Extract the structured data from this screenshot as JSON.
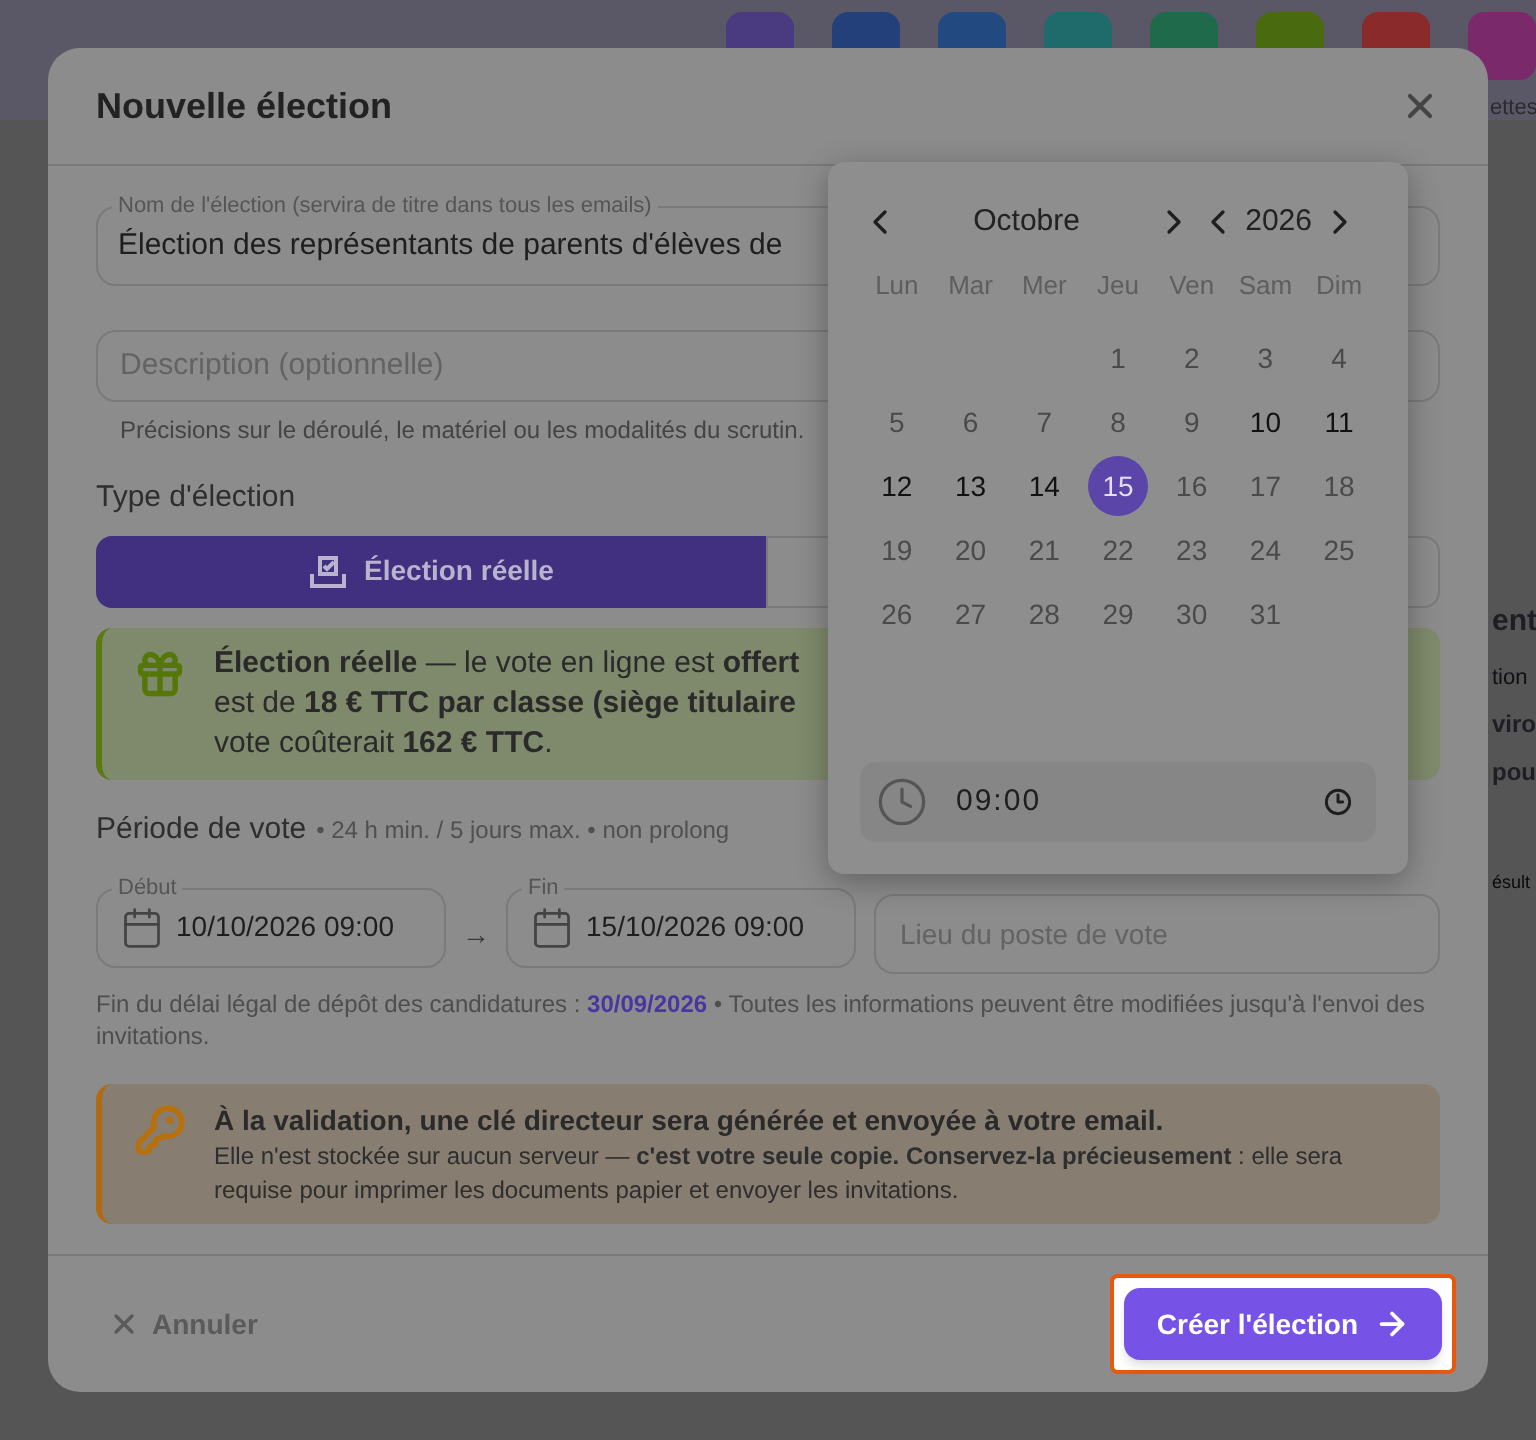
{
  "background": {
    "tiles": [
      {
        "color": "#4a3a80"
      },
      {
        "color": "#23407a"
      },
      {
        "color": "#234a80"
      },
      {
        "color": "#1f6a6a"
      },
      {
        "color": "#1f6a4a"
      },
      {
        "color": "#4a6a10"
      },
      {
        "color": "#8a2a2a"
      },
      {
        "color": "#7a2a6a"
      }
    ],
    "corner_label": "ettes",
    "fragments": [
      {
        "text": "ent",
        "kind": "heading"
      },
      {
        "text": "tion",
        "kind": "body"
      },
      {
        "text": "viro",
        "kind": "bold"
      },
      {
        "text": "pou",
        "kind": "bold"
      },
      {
        "text": "ésult",
        "kind": "small"
      }
    ]
  },
  "dialog": {
    "title": "Nouvelle élection",
    "name_field": {
      "label": "Nom de l'élection (servira de titre dans tous les emails)",
      "value": "Élection des représentants de parents d'élèves de"
    },
    "description_field": {
      "placeholder": "Description (optionnelle)",
      "hint": "Précisions sur le déroulé, le matériel ou les modalités du scrutin."
    },
    "type_label": "Type d'élection",
    "type_options": [
      {
        "label": "Élection réelle",
        "selected": true
      },
      {
        "selected": false
      }
    ],
    "offer_notice": [
      "**Élection réelle** — le vote en ligne est **offert**",
      "est de **18 € TTC par classe (siège titulaire**",
      "vote coûterait **162 € TTC**."
    ],
    "period": {
      "title": "Période de vote",
      "details": "• 24 h min. / 5 jours max. • non prolong",
      "start": {
        "label": "Début",
        "value": "10/10/2026 09:00"
      },
      "separator": "→",
      "end": {
        "label": "Fin",
        "value": "15/10/2026 09:00"
      },
      "place": {
        "placeholder": "Lieu du poste de vote"
      },
      "note": {
        "before": "Fin du délai légal de dépôt des candidatures : ",
        "date": "30/09/2026",
        "after": " • Toutes les informations peuvent être modifiées jusqu'à l'envoi des invitations."
      }
    },
    "key_notice": {
      "title": "À la validation, une clé directeur sera générée et envoyée à votre email.",
      "text": "Elle n'est stockée sur aucun serveur — **c'est votre seule copie. Conservez-la précieusement** : elle sera requise pour imprimer les documents papier et envoyer les invitations."
    },
    "footer": {
      "cancel": "Annuler",
      "submit": "Créer l'élection",
      "submit_highlighted": true
    }
  },
  "date_picker": {
    "month": "Octobre",
    "year": "2026",
    "weekdays": [
      "Lun",
      "Mar",
      "Mer",
      "Jeu",
      "Ven",
      "Sam",
      "Dim"
    ],
    "days": [
      {
        "kind": "blank"
      },
      {
        "kind": "blank"
      },
      {
        "kind": "blank"
      },
      {
        "kind": "day",
        "label": "1",
        "disabled": true,
        "selected": false
      },
      {
        "kind": "day",
        "label": "2",
        "disabled": true,
        "selected": false
      },
      {
        "kind": "day",
        "label": "3",
        "disabled": true,
        "selected": false
      },
      {
        "kind": "day",
        "label": "4",
        "disabled": true,
        "selected": false
      },
      {
        "kind": "day",
        "label": "5",
        "disabled": true,
        "selected": false
      },
      {
        "kind": "day",
        "label": "6",
        "disabled": true,
        "selected": false
      },
      {
        "kind": "day",
        "label": "7",
        "disabled": true,
        "selected": false
      },
      {
        "kind": "day",
        "label": "8",
        "disabled": true,
        "selected": false
      },
      {
        "kind": "day",
        "label": "9",
        "disabled": true,
        "selected": false
      },
      {
        "kind": "day",
        "label": "10",
        "disabled": false,
        "selected": false
      },
      {
        "kind": "day",
        "label": "11",
        "disabled": false,
        "selected": false
      },
      {
        "kind": "day",
        "label": "12",
        "disabled": false,
        "selected": false
      },
      {
        "kind": "day",
        "label": "13",
        "disabled": false,
        "selected": false
      },
      {
        "kind": "day",
        "label": "14",
        "disabled": false,
        "selected": false
      },
      {
        "kind": "day",
        "label": "15",
        "disabled": false,
        "selected": true
      },
      {
        "kind": "day",
        "label": "16",
        "disabled": true,
        "selected": false
      },
      {
        "kind": "day",
        "label": "17",
        "disabled": true,
        "selected": false
      },
      {
        "kind": "day",
        "label": "18",
        "disabled": true,
        "selected": false
      },
      {
        "kind": "day",
        "label": "19",
        "disabled": true,
        "selected": false
      },
      {
        "kind": "day",
        "label": "20",
        "disabled": true,
        "selected": false
      },
      {
        "kind": "day",
        "label": "21",
        "disabled": true,
        "selected": false
      },
      {
        "kind": "day",
        "label": "22",
        "disabled": true,
        "selected": false
      },
      {
        "kind": "day",
        "label": "23",
        "disabled": true,
        "selected": false
      },
      {
        "kind": "day",
        "label": "24",
        "disabled": true,
        "selected": false
      },
      {
        "kind": "day",
        "label": "25",
        "disabled": true,
        "selected": false
      },
      {
        "kind": "day",
        "label": "26",
        "disabled": true,
        "selected": false
      },
      {
        "kind": "day",
        "label": "27",
        "disabled": true,
        "selected": false
      },
      {
        "kind": "day",
        "label": "28",
        "disabled": true,
        "selected": false
      },
      {
        "kind": "day",
        "label": "29",
        "disabled": true,
        "selected": false
      },
      {
        "kind": "day",
        "label": "30",
        "disabled": true,
        "selected": false
      },
      {
        "kind": "day",
        "label": "31",
        "disabled": true,
        "selected": false
      }
    ],
    "time": "09:00"
  }
}
